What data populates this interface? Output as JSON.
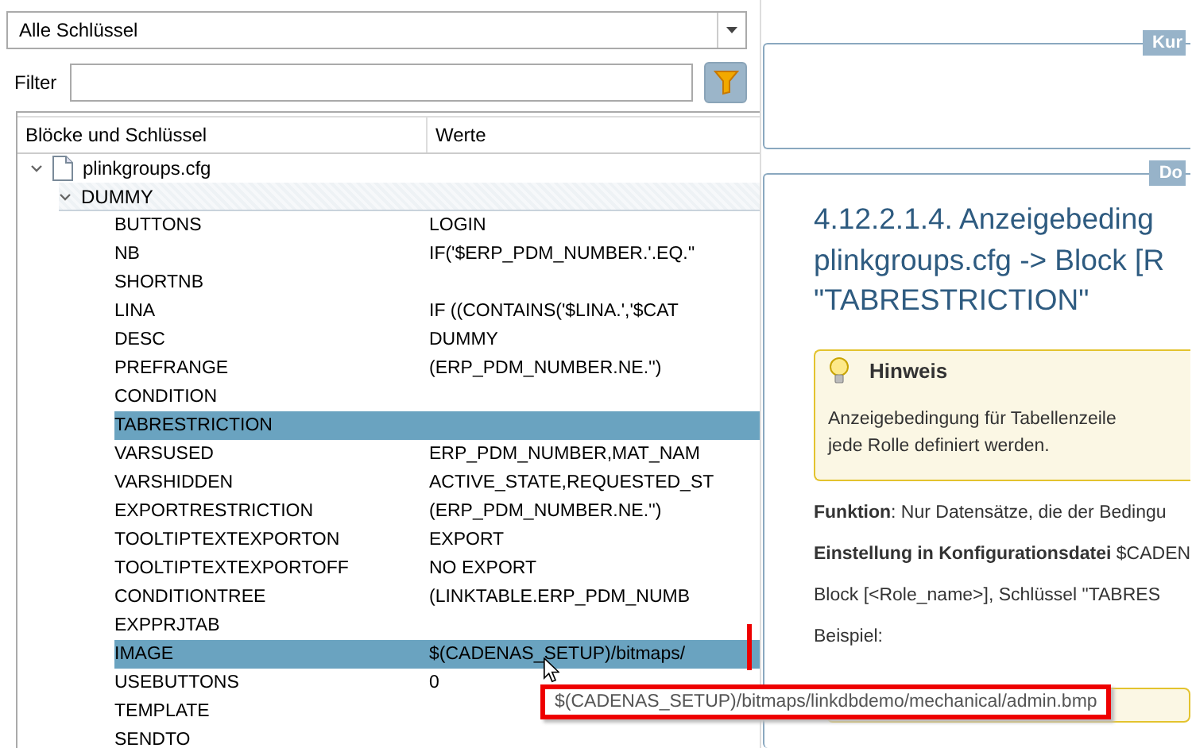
{
  "key_dropdown": {
    "value": "Alle Schlüssel"
  },
  "filter": {
    "label": "Filter"
  },
  "tree": {
    "columns": [
      "Blöcke und Schlüssel",
      "Werte"
    ],
    "items": [
      {
        "label": "plinkgroups.cfg",
        "expanded": true,
        "children": [
          {
            "label": "DUMMY",
            "expanded": true,
            "selected": false,
            "children": [
              {
                "label": "BUTTONS",
                "value": "LOGIN",
                "selected": false
              },
              {
                "label": "NB",
                "value": "IF('$ERP_PDM_NUMBER.'.EQ.''",
                "selected": false
              },
              {
                "label": "SHORTNB",
                "selected": false
              },
              {
                "label": "LINA",
                "value": "IF ((CONTAINS('$LINA.','$CAT",
                "selected": false
              },
              {
                "label": "DESC",
                "value": "DUMMY",
                "selected": false
              },
              {
                "label": "PREFRANGE",
                "value": "(ERP_PDM_NUMBER.NE.'')",
                "selected": false
              },
              {
                "label": "CONDITION",
                "selected": false
              },
              {
                "label": "TABRESTRICTION",
                "selected": true
              },
              {
                "label": "VARSUSED",
                "value": "ERP_PDM_NUMBER,MAT_NAM",
                "selected": false
              },
              {
                "label": "VARSHIDDEN",
                "value": "ACTIVE_STATE,REQUESTED_ST",
                "selected": false
              },
              {
                "label": "EXPORTRESTRICTION",
                "value": "(ERP_PDM_NUMBER.NE.'')",
                "selected": false
              },
              {
                "label": "TOOLTIPTEXTEXPORTON",
                "value": "EXPORT",
                "selected": false
              },
              {
                "label": "TOOLTIPTEXTEXPORTOFF",
                "value": "NO EXPORT",
                "selected": false
              },
              {
                "label": "CONDITIONTREE",
                "value": "(LINKTABLE.ERP_PDM_NUMB",
                "selected": false
              },
              {
                "label": "EXPPRJTAB",
                "selected": false
              },
              {
                "label": "IMAGE",
                "value": "$(CADENAS_SETUP)/bitmaps/",
                "selected": true
              },
              {
                "label": "USEBUTTONS",
                "value": "0",
                "selected": false
              },
              {
                "label": "TEMPLATE",
                "selected": false
              },
              {
                "label": "SENDTO",
                "selected": false
              }
            ]
          }
        ]
      }
    ]
  },
  "tooltip": {
    "text": "$(CADENAS_SETUP)/bitmaps/linkdbdemo/mechanical/admin.bmp"
  },
  "short_info_panel": {
    "legend": "Kur"
  },
  "doc_panel": {
    "legend": "Do",
    "heading": [
      "4.12.2.1.4. Anzeigebeding",
      "plinkgroups.cfg -> Block [R",
      "\"TABRESTRICTION\""
    ],
    "note": {
      "title": "Hinweis",
      "lines": [
        "Anzeigebedingung für Tabellenzeile",
        "jede Rolle definiert werden."
      ]
    },
    "paragraphs": [
      "**Funktion**: Nur Datensätze, die der Bedingu",
      "**Einstellung in Konfigurationsdatei** $CADEN",
      "Block [<Role_name>], Schlüssel \"TABRES",
      "Beispiel:"
    ],
    "second_note": {
      "kind": "note"
    }
  }
}
